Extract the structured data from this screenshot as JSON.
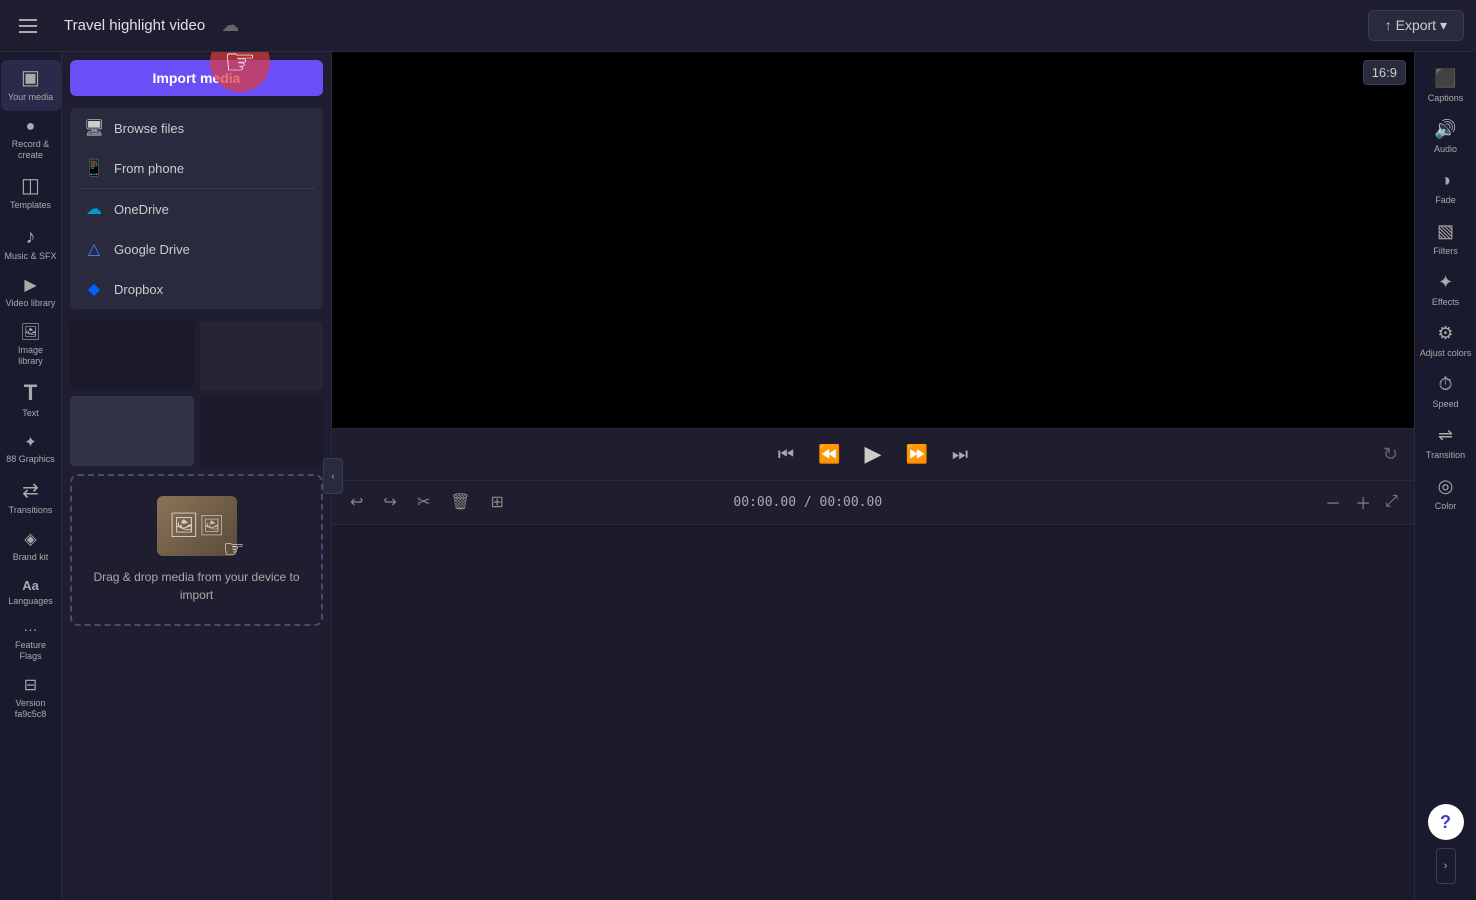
{
  "topbar": {
    "menu_label": "☰",
    "project_title": "Travel highlight video",
    "cloud_icon": "☁",
    "export_label": "↑ Export ▾",
    "aspect_ratio": "16:9"
  },
  "left_sidebar": {
    "items": [
      {
        "id": "your-media",
        "icon": "▣",
        "label": "Your media"
      },
      {
        "id": "record-create",
        "icon": "⬤",
        "label": "Record &\ncreate"
      },
      {
        "id": "templates",
        "icon": "◫",
        "label": "Templates"
      },
      {
        "id": "music-sfx",
        "icon": "♪",
        "label": "Music & SFX"
      },
      {
        "id": "video-library",
        "icon": "▶",
        "label": "Video library"
      },
      {
        "id": "image-library",
        "icon": "🖼",
        "label": "Image library"
      },
      {
        "id": "text",
        "icon": "T",
        "label": "Text"
      },
      {
        "id": "graphics",
        "icon": "✦",
        "label": "88 Graphics"
      },
      {
        "id": "transitions",
        "icon": "⇄",
        "label": "Transitions"
      },
      {
        "id": "brand-kit",
        "icon": "◈",
        "label": "Brand kit"
      },
      {
        "id": "languages",
        "icon": "Aa",
        "label": "Languages"
      },
      {
        "id": "feature-flags",
        "icon": "···",
        "label": "Feature Flags"
      },
      {
        "id": "version",
        "icon": "⊟",
        "label": "Version fa9c5c8"
      }
    ]
  },
  "panel": {
    "import_label": "Import media",
    "dropdown": {
      "browse_files": "Browse files",
      "from_phone": "From phone",
      "onedrive": "OneDrive",
      "google_drive": "Google Drive",
      "dropbox": "Dropbox"
    },
    "drop_text": "Drag & drop media from your device to import"
  },
  "video_controls": {
    "skip_back": "⏮",
    "frame_back": "⏪",
    "play": "▶",
    "frame_forward": "⏩",
    "skip_forward": "⏭",
    "refresh": "↻",
    "time_current": "00:00.00",
    "time_separator": "/",
    "time_total": "00:00.00"
  },
  "timeline": {
    "undo": "↩",
    "redo": "↪",
    "cut": "✂",
    "delete": "🗑",
    "add_track": "⊞",
    "zoom_out": "－",
    "zoom_in": "＋",
    "expand": "⤢"
  },
  "right_sidebar": {
    "items": [
      {
        "id": "captions",
        "icon": "⬛",
        "label": "Captions"
      },
      {
        "id": "audio",
        "icon": "🔊",
        "label": "Audio"
      },
      {
        "id": "fade",
        "icon": "◑",
        "label": "Fade"
      },
      {
        "id": "filters",
        "icon": "▧",
        "label": "Filters"
      },
      {
        "id": "effects",
        "icon": "✦",
        "label": "Effects"
      },
      {
        "id": "adjust-colors",
        "icon": "⚙",
        "label": "Adjust colors"
      },
      {
        "id": "speed",
        "icon": "⏱",
        "label": "Speed"
      },
      {
        "id": "transition",
        "icon": "⇌",
        "label": "Transition"
      },
      {
        "id": "color",
        "icon": "◎",
        "label": "Color"
      }
    ],
    "help_label": "?"
  }
}
